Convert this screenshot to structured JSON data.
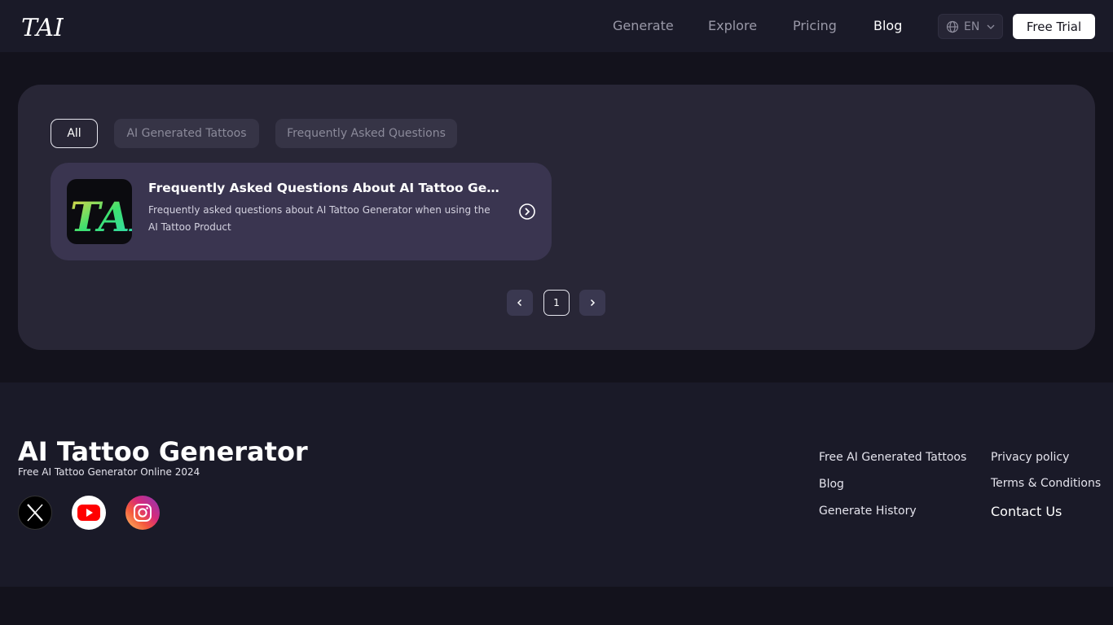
{
  "header": {
    "logo_text": "TAI",
    "nav": [
      {
        "label": "Generate",
        "active": false
      },
      {
        "label": "Explore",
        "active": false
      },
      {
        "label": "Pricing",
        "active": false
      },
      {
        "label": "Blog",
        "active": true
      }
    ],
    "language": "EN",
    "cta_label": "Free Trial"
  },
  "filters": {
    "tabs": [
      {
        "label": "All",
        "selected": true
      },
      {
        "label": "AI Generated Tattoos",
        "selected": false
      },
      {
        "label": "Frequently Asked Questions",
        "selected": false
      }
    ]
  },
  "posts": [
    {
      "title": "Frequently Asked Questions About AI Tattoo Generator",
      "description": "Frequently asked questions about AI Tattoo Generator when using the AI Tattoo Product",
      "thumbnail_text": "TAI"
    }
  ],
  "pagination": {
    "current_page": "1"
  },
  "footer": {
    "title": "AI Tattoo Generator",
    "subtitle": "Free AI Tattoo Generator Online 2024",
    "social": [
      "x-icon",
      "youtube-icon",
      "instagram-icon"
    ],
    "links_col1": [
      "Free AI Generated Tattoos",
      "Blog",
      "Generate History"
    ],
    "links_col2": [
      "Privacy policy",
      "Terms & Conditions",
      "Contact Us"
    ]
  }
}
